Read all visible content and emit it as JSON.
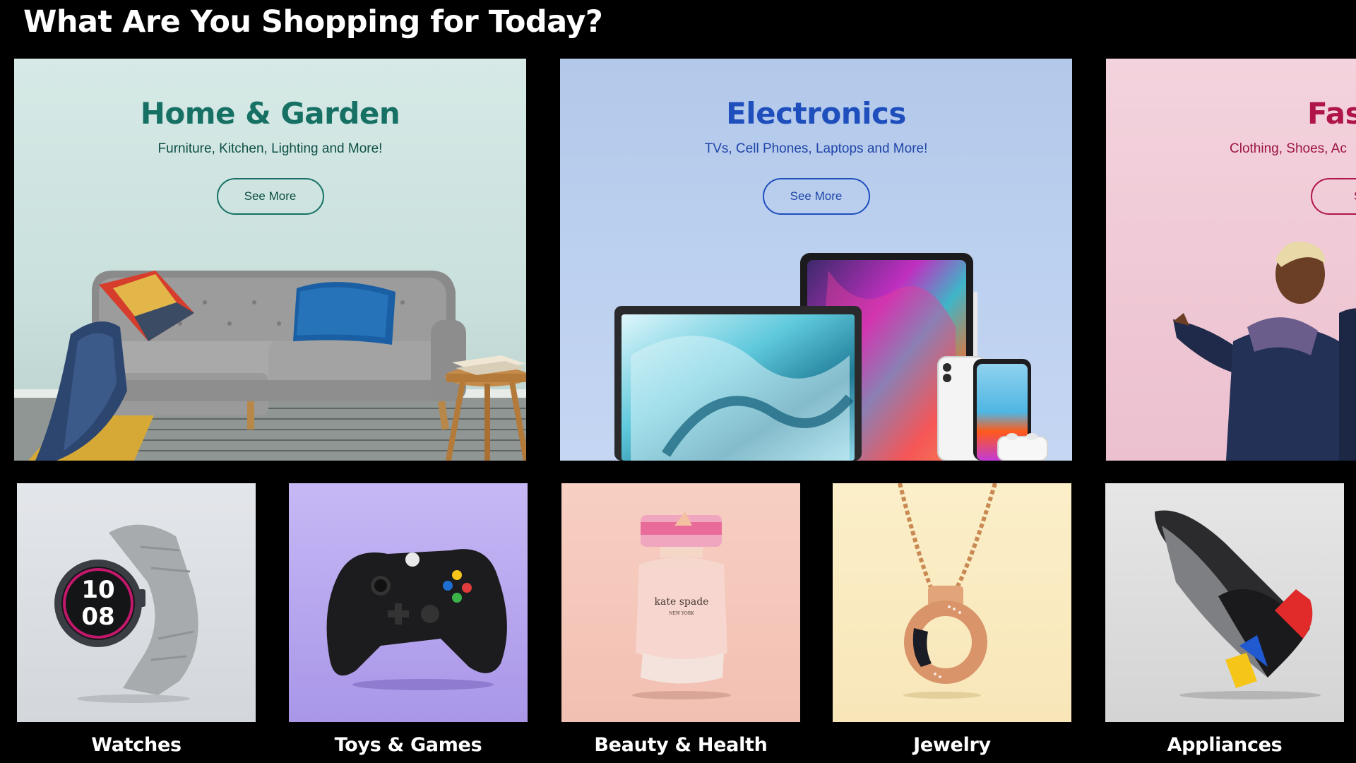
{
  "section": {
    "title": "What Are You Shopping for Today?"
  },
  "big_cards": [
    {
      "title": "Home & Garden",
      "subtitle": "Furniture, Kitchen, Lighting and More!",
      "button": "See More",
      "accent": "#167064"
    },
    {
      "title": "Electronics",
      "subtitle": "TVs, Cell Phones, Laptops and More!",
      "button": "See More",
      "accent": "#1f4fbd"
    },
    {
      "title": "Fas",
      "subtitle": "Clothing, Shoes, Ac",
      "button": "See",
      "accent": "#b0154a"
    }
  ],
  "small_cards": [
    {
      "label": "Watches",
      "icon": "smartwatch-icon"
    },
    {
      "label": "Toys & Games",
      "icon": "game-controller-icon"
    },
    {
      "label": "Beauty & Health",
      "icon": "perfume-bottle-icon"
    },
    {
      "label": "Jewelry",
      "icon": "necklace-icon"
    },
    {
      "label": "Appliances",
      "icon": "steam-iron-icon"
    }
  ],
  "watch_face": {
    "hour": "10",
    "minute": "08"
  },
  "perfume_brand": {
    "name": "kate spade",
    "city": "NEW YORK"
  }
}
